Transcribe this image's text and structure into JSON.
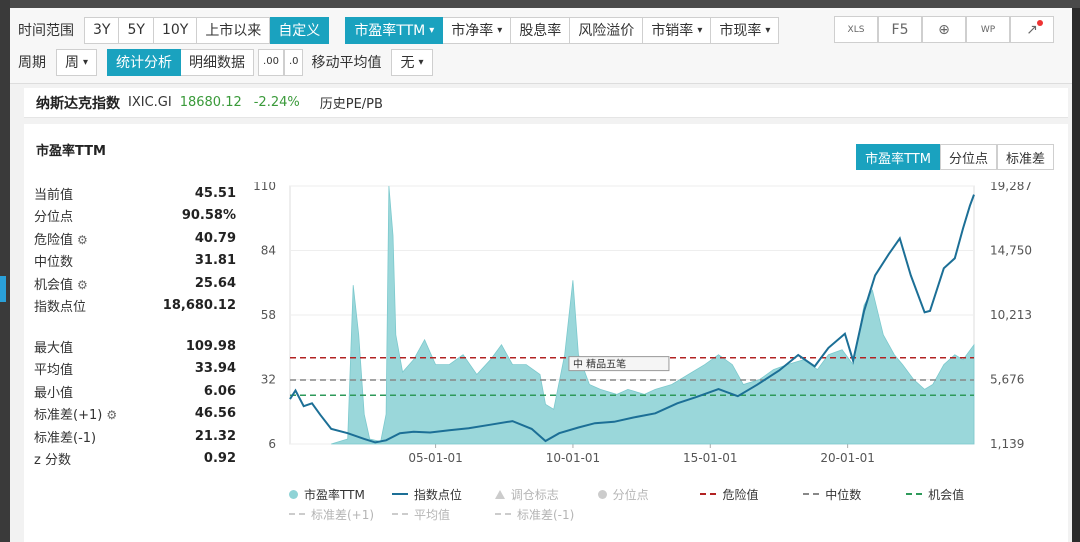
{
  "toolbar": {
    "row1": {
      "range_label": "时间范围",
      "ranges": [
        "3Y",
        "5Y",
        "10Y",
        "上市以来",
        "自定义"
      ],
      "metrics": [
        {
          "label": "市盈率TTM",
          "dropdown": true
        },
        {
          "label": "市净率",
          "dropdown": true
        },
        {
          "label": "股息率",
          "dropdown": false
        },
        {
          "label": "风险溢价",
          "dropdown": false
        },
        {
          "label": "市销率",
          "dropdown": true
        },
        {
          "label": "市现率",
          "dropdown": true
        }
      ]
    },
    "row2": {
      "period_label": "周期",
      "period_value": "周",
      "views": [
        "统计分析",
        "明细数据"
      ],
      "decimal_inc": ".00",
      "decimal_dec": ".0",
      "ma_label": "移动平均值",
      "ma_value": "无"
    },
    "right": [
      "XLS",
      "F5",
      "⊕",
      "WP",
      "↗"
    ]
  },
  "index": {
    "name": "纳斯达克指数",
    "code": "IXIC.GI",
    "value": "18680.12",
    "change": "-2.24%",
    "history": "历史PE/PB"
  },
  "panel": {
    "title": "市盈率TTM",
    "tabs": [
      "市盈率TTM",
      "分位点",
      "标准差"
    ]
  },
  "stats": {
    "top": [
      {
        "label": "当前值",
        "value": "45.51",
        "gear": false
      },
      {
        "label": "分位点",
        "value": "90.58%",
        "gear": false
      },
      {
        "label": "危险值",
        "value": "40.79",
        "gear": true
      },
      {
        "label": "中位数",
        "value": "31.81",
        "gear": false
      },
      {
        "label": "机会值",
        "value": "25.64",
        "gear": true
      },
      {
        "label": "指数点位",
        "value": "18,680.12",
        "gear": false
      }
    ],
    "bottom": [
      {
        "label": "最大值",
        "value": "109.98",
        "gear": false
      },
      {
        "label": "平均值",
        "value": "33.94",
        "gear": false
      },
      {
        "label": "最小值",
        "value": "6.06",
        "gear": false
      },
      {
        "label": "标准差(+1)",
        "value": "46.56",
        "gear": true
      },
      {
        "label": "标准差(-1)",
        "value": "21.32",
        "gear": false
      },
      {
        "label": "z 分数",
        "value": "0.92",
        "gear": false
      }
    ]
  },
  "chart_data": {
    "type": "area",
    "left_axis": {
      "ticks": [
        "110",
        "84",
        "58",
        "32",
        "6"
      ],
      "ylim": [
        6,
        110
      ]
    },
    "right_axis": {
      "ticks": [
        "19,287",
        "14,750",
        "10,213",
        "5,676",
        "1,139"
      ],
      "ylim": [
        1139,
        19287
      ]
    },
    "x_ticks": [
      "05-01-01",
      "10-01-01",
      "15-01-01",
      "20-01-01"
    ],
    "x_range": [
      1999.7,
      2024.6
    ],
    "series": [
      {
        "name": "市盈率TTM",
        "kind": "area",
        "color": "#8fd3d6",
        "points": [
          [
            2001.2,
            6
          ],
          [
            2001.8,
            8
          ],
          [
            2002.0,
            70
          ],
          [
            2002.2,
            50
          ],
          [
            2002.4,
            18
          ],
          [
            2002.6,
            8
          ],
          [
            2003.0,
            7
          ],
          [
            2003.2,
            18
          ],
          [
            2003.3,
            110
          ],
          [
            2003.45,
            90
          ],
          [
            2003.55,
            50
          ],
          [
            2003.8,
            35
          ],
          [
            2004.2,
            40
          ],
          [
            2004.6,
            48
          ],
          [
            2005.0,
            38
          ],
          [
            2005.5,
            38
          ],
          [
            2006.0,
            42
          ],
          [
            2006.5,
            34
          ],
          [
            2007.0,
            40
          ],
          [
            2007.4,
            46
          ],
          [
            2007.8,
            38
          ],
          [
            2008.3,
            38
          ],
          [
            2008.8,
            34
          ],
          [
            2009.0,
            22
          ],
          [
            2009.3,
            20
          ],
          [
            2009.7,
            42
          ],
          [
            2010.0,
            72
          ],
          [
            2010.2,
            42
          ],
          [
            2010.6,
            30
          ],
          [
            2011.0,
            28
          ],
          [
            2011.6,
            26
          ],
          [
            2012.0,
            28
          ],
          [
            2012.6,
            26
          ],
          [
            2013.0,
            28
          ],
          [
            2013.6,
            30
          ],
          [
            2014.2,
            34
          ],
          [
            2014.8,
            38
          ],
          [
            2015.3,
            42
          ],
          [
            2015.8,
            38
          ],
          [
            2016.2,
            30
          ],
          [
            2016.8,
            32
          ],
          [
            2017.3,
            36
          ],
          [
            2017.8,
            38
          ],
          [
            2018.4,
            40
          ],
          [
            2018.9,
            36
          ],
          [
            2019.3,
            42
          ],
          [
            2019.8,
            44
          ],
          [
            2020.2,
            38
          ],
          [
            2020.6,
            62
          ],
          [
            2020.9,
            68
          ],
          [
            2021.3,
            50
          ],
          [
            2021.7,
            42
          ],
          [
            2022.0,
            38
          ],
          [
            2022.4,
            32
          ],
          [
            2022.8,
            28
          ],
          [
            2023.1,
            30
          ],
          [
            2023.5,
            38
          ],
          [
            2023.9,
            42
          ],
          [
            2024.2,
            40
          ],
          [
            2024.6,
            46
          ]
        ]
      },
      {
        "name": "指数点位",
        "kind": "line",
        "axis": "right",
        "color": "#1c6f96",
        "points": [
          [
            1999.7,
            4300
          ],
          [
            1999.9,
            4900
          ],
          [
            2000.2,
            3800
          ],
          [
            2000.5,
            4000
          ],
          [
            2000.8,
            3200
          ],
          [
            2001.2,
            2200
          ],
          [
            2001.8,
            1900
          ],
          [
            2002.4,
            1500
          ],
          [
            2002.8,
            1250
          ],
          [
            2003.2,
            1400
          ],
          [
            2003.7,
            1900
          ],
          [
            2004.2,
            2000
          ],
          [
            2004.8,
            1950
          ],
          [
            2005.5,
            2100
          ],
          [
            2006.2,
            2250
          ],
          [
            2007.0,
            2500
          ],
          [
            2007.8,
            2750
          ],
          [
            2008.5,
            2200
          ],
          [
            2009.0,
            1350
          ],
          [
            2009.5,
            1900
          ],
          [
            2010.2,
            2300
          ],
          [
            2010.8,
            2600
          ],
          [
            2011.5,
            2700
          ],
          [
            2012.2,
            3000
          ],
          [
            2013.0,
            3300
          ],
          [
            2013.8,
            4000
          ],
          [
            2014.5,
            4450
          ],
          [
            2015.3,
            5000
          ],
          [
            2016.0,
            4500
          ],
          [
            2016.7,
            5300
          ],
          [
            2017.5,
            6300
          ],
          [
            2018.2,
            7400
          ],
          [
            2018.8,
            6600
          ],
          [
            2019.3,
            7900
          ],
          [
            2019.9,
            8900
          ],
          [
            2020.2,
            7000
          ],
          [
            2020.6,
            10500
          ],
          [
            2021.0,
            13000
          ],
          [
            2021.5,
            14500
          ],
          [
            2021.9,
            15600
          ],
          [
            2022.3,
            13000
          ],
          [
            2022.8,
            10400
          ],
          [
            2023.0,
            10500
          ],
          [
            2023.5,
            13500
          ],
          [
            2023.9,
            14200
          ],
          [
            2024.2,
            16300
          ],
          [
            2024.45,
            17900
          ],
          [
            2024.6,
            18680
          ]
        ]
      },
      {
        "name": "调仓标志",
        "kind": "marker",
        "color": "#cccccc",
        "points": []
      },
      {
        "name": "分位点",
        "kind": "dot",
        "color": "#cccccc",
        "points": []
      },
      {
        "name": "危险值",
        "kind": "hline",
        "color": "#b22222",
        "value": 40.79
      },
      {
        "name": "中位数",
        "kind": "hline",
        "color": "#888888",
        "value": 31.81
      },
      {
        "name": "机会值",
        "kind": "hline",
        "color": "#2e9a5a",
        "value": 25.64
      }
    ],
    "annotation": {
      "text": "中 精品五笔",
      "x": 2010.0,
      "y": 38
    }
  },
  "legend": {
    "row1": [
      {
        "label": "市盈率TTM",
        "swatch": "dot",
        "color": "#8fd3d6",
        "dim": false
      },
      {
        "label": "指数点位",
        "swatch": "line",
        "color": "#1c6f96",
        "dim": false
      },
      {
        "label": "调仓标志",
        "swatch": "tri",
        "color": "#cccccc",
        "dim": true
      },
      {
        "label": "分位点",
        "swatch": "dot",
        "color": "#cccccc",
        "dim": true
      },
      {
        "label": "危险值",
        "swatch": "dash",
        "color": "#b22222",
        "dim": false
      },
      {
        "label": "中位数",
        "swatch": "dash",
        "color": "#888888",
        "dim": false
      },
      {
        "label": "机会值",
        "swatch": "dash",
        "color": "#2e9a5a",
        "dim": false
      }
    ],
    "row2": [
      {
        "label": "标准差(+1)",
        "swatch": "dash",
        "color": "#cccccc",
        "dim": true
      },
      {
        "label": "平均值",
        "swatch": "dash",
        "color": "#cccccc",
        "dim": true
      },
      {
        "label": "标准差(-1)",
        "swatch": "dash",
        "color": "#cccccc",
        "dim": true
      }
    ]
  }
}
